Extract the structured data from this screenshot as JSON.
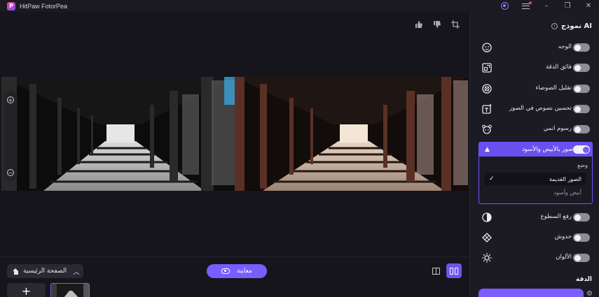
{
  "app": {
    "title": "HitPaw FotorPea",
    "logo_letter": "P"
  },
  "window_controls": {
    "account": "account-icon",
    "menu": "menu-icon",
    "minimize": "–",
    "restore": "❐",
    "close": "✕"
  },
  "canvas": {
    "tools": [
      "thumbs-up-icon",
      "thumbs-down-icon",
      "crop-icon"
    ],
    "zoom": {
      "in": "+",
      "out": "−"
    }
  },
  "bottom": {
    "home_label": "الصفحة الرئيسية",
    "collapse_glyph": "︿",
    "preview_label": "معاينة",
    "add_glyph": "+"
  },
  "panel": {
    "title": "نموذج AI",
    "info_glyph": "i",
    "features": [
      {
        "label": "الوجه",
        "icon": "face-icon",
        "on": false
      },
      {
        "label": "فائق الدقة",
        "icon": "super-resolution-icon",
        "on": false
      },
      {
        "label": "تقليل الضوضاء",
        "icon": "denoise-icon",
        "on": false
      },
      {
        "label": "تحسين نصوص في الصور",
        "icon": "text-enhance-icon",
        "on": false
      },
      {
        "label": "رسوم انمي",
        "icon": "anime-icon",
        "on": false
      }
    ],
    "bw": {
      "label": "صور بالأبيض والأسود",
      "on": true,
      "mode_label": "وضع",
      "options": [
        {
          "label": "الصور القديمة",
          "selected": true
        },
        {
          "label": "أبيض وأسود",
          "selected": false
        }
      ]
    },
    "features2": [
      {
        "label": "رفع السطوع",
        "icon": "brightness-icon",
        "on": false
      },
      {
        "label": "خدوش",
        "icon": "scratch-icon",
        "on": false
      },
      {
        "label": "الألوان",
        "icon": "color-icon",
        "on": false
      }
    ],
    "resolution_label": "الدقة"
  },
  "colors": {
    "accent": "#7a5cff",
    "panel_bg": "#1c1b23",
    "canvas_bg": "#16151c"
  }
}
